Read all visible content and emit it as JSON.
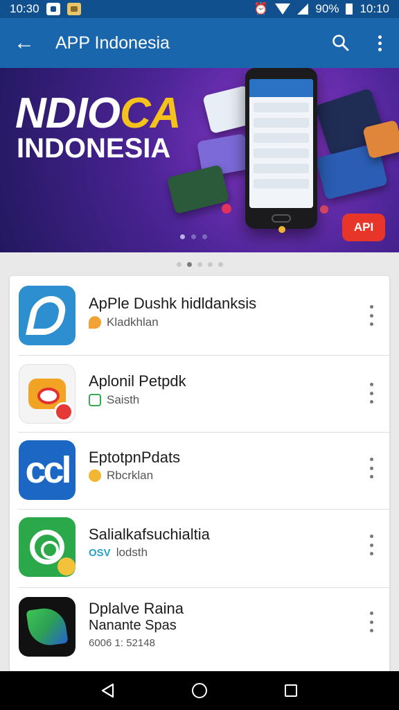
{
  "status_bar": {
    "time_left": "10:30",
    "battery": "90%",
    "time_right": "10:10"
  },
  "app_bar": {
    "title": "APP Indonesia",
    "back_icon": "arrow-left-icon",
    "search_icon": "search-icon",
    "more_icon": "more-vert-icon"
  },
  "banner": {
    "title_part1": "NDIO",
    "title_part2": "CA",
    "subtitle": "INDONESIA",
    "badge": "API",
    "colors": {
      "yellow": "#f5c21b",
      "badge": "#e8352a"
    }
  },
  "apps": [
    {
      "title": "ApPle Dushk hidldanksis",
      "subtitle": "Kladkhlan",
      "icon": "pencil-p-icon",
      "sub_icon": "tag-icon"
    },
    {
      "title": "Aplonil Petpdk",
      "subtitle": "Saisth",
      "icon": "chat-bubble-icon",
      "sub_icon": "calendar-icon"
    },
    {
      "title": "EptotpnPdats",
      "subtitle": "Rbcrklan",
      "icon": "ccl-icon",
      "icon_text": "ccl",
      "sub_icon": "smile-icon"
    },
    {
      "title": "Salialkafsuchialtia",
      "subtitle": "lodsth",
      "sub_prefix": "OSV",
      "icon": "refresh-circle-icon"
    },
    {
      "title": "Dplalve Raina",
      "subtitle2": "Nanante Spas",
      "meta": "6006 1: 52148",
      "icon": "leaf-icon"
    }
  ],
  "nav_bar": {
    "back": "nav-back-icon",
    "home": "nav-home-icon",
    "recents": "nav-recents-icon"
  }
}
